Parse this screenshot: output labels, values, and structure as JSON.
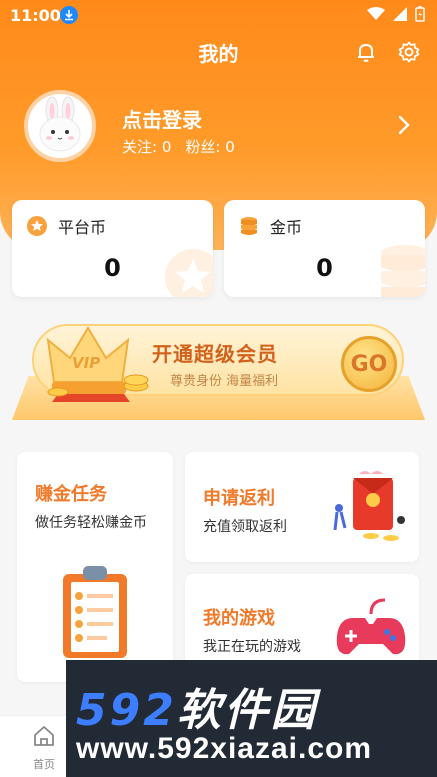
{
  "status_bar": {
    "time": "11:00"
  },
  "header": {
    "title": "我的"
  },
  "profile": {
    "login_label": "点击登录",
    "follow_label": "关注:",
    "follow_count": "0",
    "fans_label": "粉丝:",
    "fans_count": "0"
  },
  "coins": {
    "platform": {
      "label": "平台币",
      "value": "0"
    },
    "gold": {
      "label": "金币",
      "value": "0"
    }
  },
  "vip": {
    "badge": "VIP",
    "title": "开通超级会员",
    "subtitle": "尊贵身份 海量福利",
    "go_label": "GO"
  },
  "cards": {
    "earn": {
      "title": "赚金任务",
      "subtitle": "做任务轻松赚金币"
    },
    "rebate": {
      "title": "申请返利",
      "subtitle": "充值领取返利"
    },
    "games": {
      "title": "我的游戏",
      "subtitle": "我正在玩的游戏"
    }
  },
  "tabbar": {
    "home_label": "首页"
  },
  "watermark": {
    "brand_number": "592",
    "brand_cn": "软件园",
    "url": "www.592xiazai.com"
  },
  "colors": {
    "accent": "#ff8a1a",
    "card_title": "#f07a2a",
    "watermark_bg": "#222a36",
    "watermark_blue": "#3d7dff"
  }
}
